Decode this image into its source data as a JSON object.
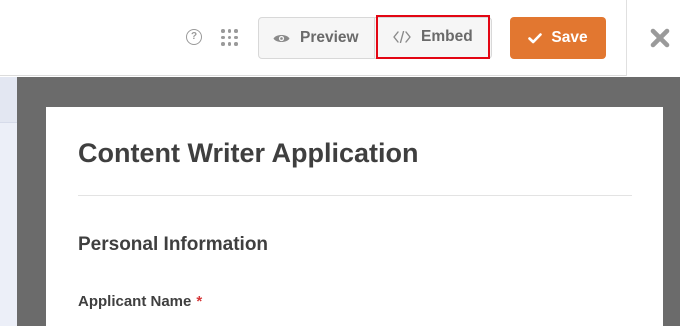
{
  "toolbar": {
    "help_icon": "question-circle-icon",
    "help_glyph": "?",
    "grid_icon": "dots-grid-icon",
    "preview_label": "Preview",
    "preview_icon": "eye-icon",
    "embed_label": "Embed",
    "embed_icon": "code-icon",
    "save_label": "Save",
    "save_icon": "checkmark-icon",
    "close_icon": "close-icon",
    "highlight_color": "#e30613",
    "save_color": "#e27730"
  },
  "form": {
    "title": "Content Writer Application",
    "section_title": "Personal Information",
    "fields": [
      {
        "label": "Applicant Name",
        "required_mark": "*"
      }
    ]
  }
}
